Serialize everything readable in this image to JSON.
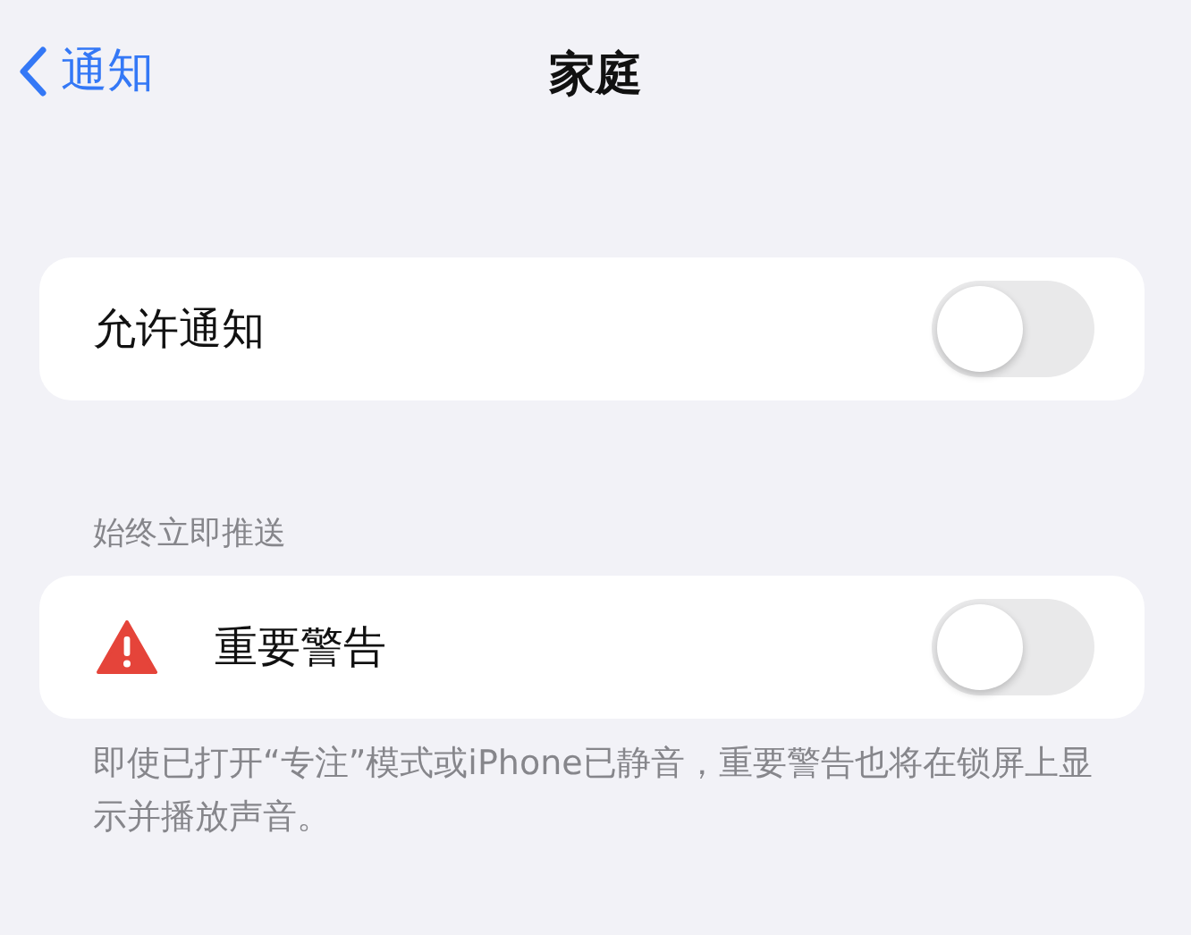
{
  "nav": {
    "back_label": "通知",
    "title": "家庭"
  },
  "groups": [
    {
      "rows": [
        {
          "kind": "plain",
          "label": "允许通知",
          "on": false
        }
      ]
    },
    {
      "header": "始终立即推送",
      "rows": [
        {
          "kind": "alert",
          "label": "重要警告",
          "on": false
        }
      ],
      "footer": "即使已打开“专注”模式或iPhone已静音，重要警告也将在锁屏上显示并播放声音。"
    }
  ]
}
